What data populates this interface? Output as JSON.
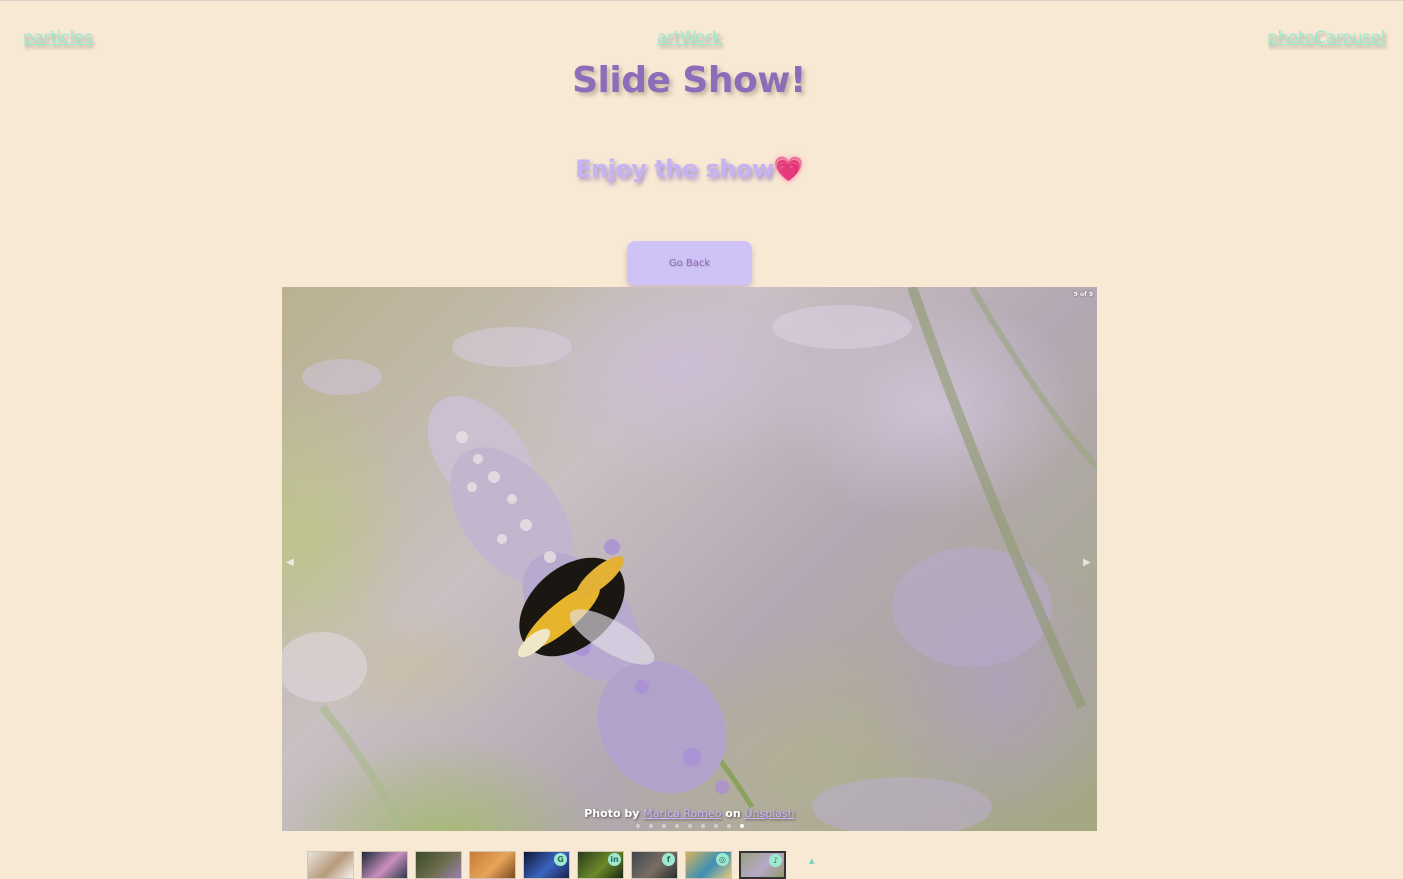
{
  "nav": {
    "left": "particles",
    "center": "artWork",
    "right": "photoCarousel"
  },
  "header": {
    "title": "Slide Show!",
    "subtitle": "Enjoy the show",
    "subtitle_emoji": "💗"
  },
  "actions": {
    "go_back": "Go Back"
  },
  "slideshow": {
    "counter": "9 of 9",
    "caption_prefix": "Photo by",
    "photographer": "Marica Romeo",
    "caption_mid": "on",
    "source": "Unsplash",
    "total_slides": 9,
    "active_index": 9
  },
  "thumbnails": [
    {
      "subject": "squirrel",
      "social_icon": null,
      "colors": [
        "#e7e4dc",
        "#b79a7b",
        "#f5f2ec"
      ]
    },
    {
      "subject": "pink flower",
      "social_icon": null,
      "colors": [
        "#1d2a36",
        "#c98fbf",
        "#2d3a48"
      ]
    },
    {
      "subject": "landscape",
      "social_icon": null,
      "colors": [
        "#3c4a2a",
        "#6e6d4f",
        "#9a7fb0"
      ]
    },
    {
      "subject": "cat",
      "social_icon": null,
      "colors": [
        "#c97a34",
        "#e6a45a",
        "#7a4a20"
      ]
    },
    {
      "subject": "blue bird",
      "social_icon": "github-icon",
      "colors": [
        "#0d1635",
        "#3b64c0",
        "#1b2250"
      ]
    },
    {
      "subject": "leaves",
      "social_icon": "linkedin-icon",
      "colors": [
        "#2b3a1a",
        "#6b8a2a",
        "#1d2712"
      ]
    },
    {
      "subject": "cat on stairs",
      "social_icon": "facebook-icon",
      "colors": [
        "#3d4650",
        "#7a6e62",
        "#2a2f35"
      ]
    },
    {
      "subject": "kingfisher",
      "social_icon": "instagram-icon",
      "colors": [
        "#d6b35c",
        "#3d8fb5",
        "#e7c97a"
      ]
    },
    {
      "subject": "bee on lavender",
      "social_icon": "tiktok-icon",
      "colors": [
        "#9aa17f",
        "#b7a8c9",
        "#8f9a6a"
      ]
    }
  ],
  "social_glyphs": {
    "github-icon": "G",
    "linkedin-icon": "in",
    "facebook-icon": "f",
    "instagram-icon": "◎",
    "tiktok-icon": "♪"
  },
  "colors": {
    "background": "#f8e9d4",
    "nav_link": "#9de9cf",
    "title": "#8d6cb9",
    "subtitle": "#c6b4f2",
    "button": "#cfc2f7"
  }
}
